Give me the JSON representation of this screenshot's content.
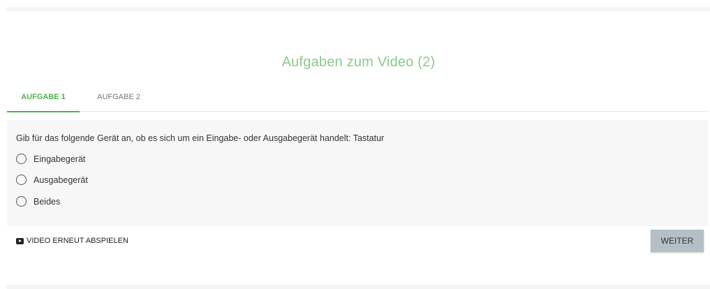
{
  "title": "Aufgaben zum Video (2)",
  "tabs": [
    {
      "label": "AUFGABE 1",
      "active": true
    },
    {
      "label": "AUFGABE 2",
      "active": false
    }
  ],
  "question": {
    "text": "Gib für das folgende Gerät an, ob es sich um ein Eingabe- oder Ausgabegerät handelt: Tastatur",
    "options": [
      {
        "label": "Eingabegerät",
        "selected": false
      },
      {
        "label": "Ausgabegerät",
        "selected": false
      },
      {
        "label": "Beides",
        "selected": false
      }
    ]
  },
  "actions": {
    "replay_label": "VIDEO ERNEUT ABSPIELEN",
    "replay_icon": "video-play-icon",
    "next_label": "WEITER"
  },
  "colors": {
    "title": "#8cc98c",
    "active_tab": "#4fb04f",
    "panel_bg": "#f7f7f7",
    "next_button_bg": "#b4bfc6"
  }
}
